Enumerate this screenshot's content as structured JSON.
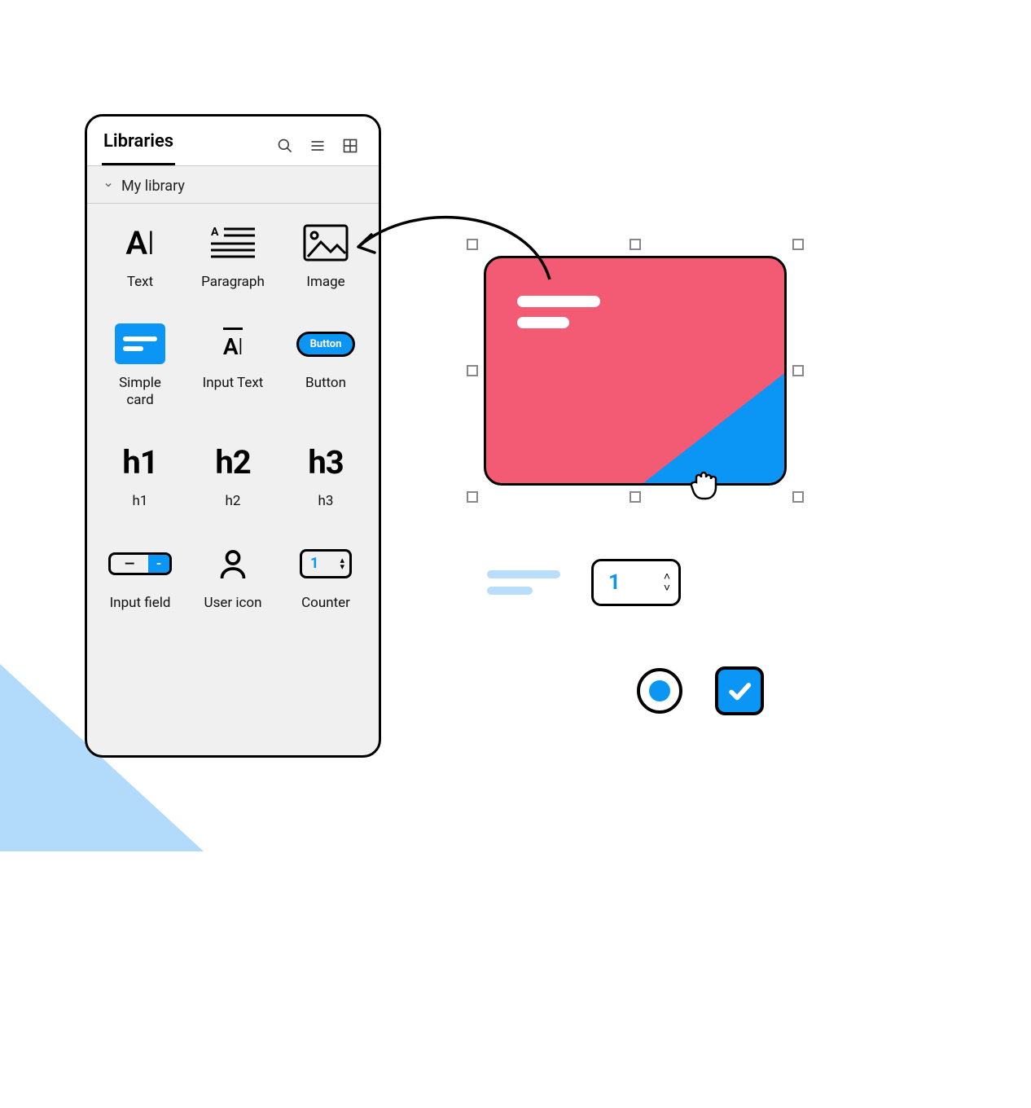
{
  "panel": {
    "tab_label": "Libraries",
    "section_name": "My library"
  },
  "library_items": [
    {
      "label": "Text"
    },
    {
      "label": "Paragraph"
    },
    {
      "label": "Image"
    },
    {
      "label": "Simple card"
    },
    {
      "label": "Input Text"
    },
    {
      "label": "Button",
      "button_text": "Button"
    },
    {
      "label": "h1",
      "glyph": "h1"
    },
    {
      "label": "h2",
      "glyph": "h2"
    },
    {
      "label": "h3",
      "glyph": "h3"
    },
    {
      "label": "Input field"
    },
    {
      "label": "User icon"
    },
    {
      "label": "Counter",
      "counter_value": "1"
    }
  ],
  "canvas": {
    "counter_value": "1"
  },
  "colors": {
    "accent": "#0b96f5",
    "card_bg": "#f35a73"
  }
}
